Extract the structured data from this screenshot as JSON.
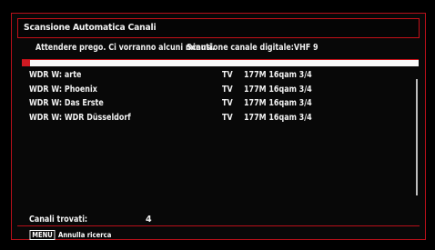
{
  "dialog": {
    "title": "Scansione Automatica Canali",
    "wait_message": "Attendere prego. Ci vorranno alcuni minuti.",
    "scan_status": "Scansione canale digitale:VHF 9",
    "progress_fraction": 0.02
  },
  "channels": [
    {
      "name": "WDR W: arte",
      "type": "TV",
      "info": "177M 16qam 3/4"
    },
    {
      "name": "WDR W: Phoenix",
      "type": "TV",
      "info": "177M 16qam 3/4"
    },
    {
      "name": "WDR W: Das Erste",
      "type": "TV",
      "info": "177M 16qam 3/4"
    },
    {
      "name": "WDR W: WDR Düsseldorf",
      "type": "TV",
      "info": "177M 16qam 3/4"
    }
  ],
  "summary": {
    "found_label": "Canali trovati:",
    "found_count": "4"
  },
  "footer": {
    "menu_key": "MENU",
    "menu_hint": "Annulla ricerca"
  },
  "colors": {
    "accent_red": "#c41018",
    "background": "#000000"
  }
}
